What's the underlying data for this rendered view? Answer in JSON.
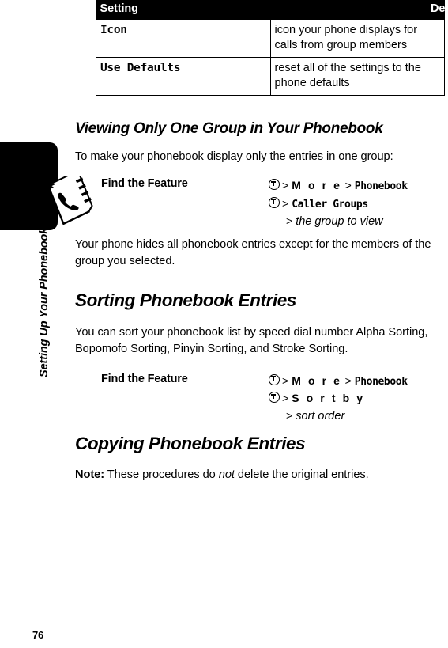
{
  "running_head": "Setting Up Your Phonebook",
  "page_number": "76",
  "icons": {
    "phonebook": "phonebook-icon",
    "menu_key": "menu-key-icon"
  },
  "table": {
    "headers": [
      "Setting",
      "Description"
    ],
    "rows": [
      {
        "setting": "Icon",
        "description": "icon your phone displays for calls from group members"
      },
      {
        "setting": "Use Defaults",
        "description": "reset all of the settings to the phone defaults"
      }
    ]
  },
  "sections": [
    {
      "heading": "Viewing Only One Group in Your Phonebook",
      "intro": "To make your phonebook display only the entries in one group:",
      "find_the_feature": {
        "label": "Find the Feature",
        "lines": [
          {
            "key": true,
            "gt": ">",
            "item": "M o r e",
            "spaced": true,
            "gt2": ">",
            "item2": "Phonebook"
          },
          {
            "key": true,
            "gt": ">",
            "item": "Caller Groups",
            "spaced": false
          },
          {
            "key": false,
            "gt": ">",
            "item": "the group to view",
            "italic": true
          }
        ]
      },
      "outro": "Your phone hides all phonebook entries except for the members of the group you selected."
    },
    {
      "heading": "Sorting Phonebook Entries",
      "intro": "You can sort your phonebook list by speed dial number Alpha Sorting, Bopomofo Sorting, Pinyin Sorting, and Stroke Sorting.",
      "find_the_feature": {
        "label": "Find the Feature",
        "lines": [
          {
            "key": true,
            "gt": ">",
            "item": "M o r e",
            "spaced": true,
            "gt2": ">",
            "item2": "Phonebook"
          },
          {
            "key": true,
            "gt": ">",
            "item": "S o r t   b y",
            "spaced": true
          },
          {
            "key": false,
            "gt": ">",
            "item": "sort order",
            "italic": true
          }
        ]
      }
    },
    {
      "heading": "Copying Phonebook Entries",
      "note_label": "Note:",
      "note_pre": " These procedures do ",
      "note_em": "not",
      "note_post": " delete the original entries."
    }
  ]
}
